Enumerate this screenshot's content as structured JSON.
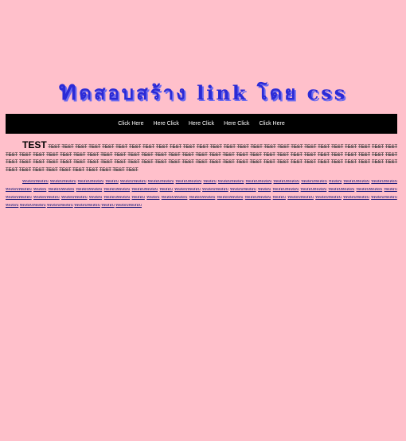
{
  "page": {
    "title_first": "ท",
    "title_rest": "ดสอบสร้าง link โดย css"
  },
  "nav": {
    "items": [
      {
        "label": "Click Here"
      },
      {
        "label": "Here Click"
      },
      {
        "label": "Here Click"
      },
      {
        "label": "Here Click"
      },
      {
        "label": "Click Here"
      }
    ]
  },
  "content": {
    "heading_word": "TEST",
    "test_word": "TEST",
    "test_count": 94,
    "link_word": "ทดสอบ",
    "link_phrases": [
      "ทดสอบทดสอบ",
      "ทดสอบทดสอบ",
      "ทดสอบทดสอบ",
      "ทดสอบ",
      "ทดสอบทดสอบ",
      "ทดสอบทดสอบ",
      "ทดสอบทดสอบ",
      "ทดสอบ",
      "ทดสอบทดสอบ",
      "ทดสอบทดสอบ",
      "ทดสอบทดสอบ",
      "ทดสอบทดสอบ",
      "ทดสอบ",
      "ทดสอบทดสอบ",
      "ทดสอบทดสอบ",
      "ทดสอบทดสอบ",
      "ทดสอบ",
      "ทดสอบทดสอบ",
      "ทดสอบทดสอบ",
      "ทดสอบทดสอบ",
      "ทดสอบทดสอบ",
      "ทดสอบ",
      "ทดสอบทดสอบ",
      "ทดสอบทดสอบ",
      "ทดสอบทดสอบ",
      "ทดสอบ",
      "ทดสอบทดสอบ",
      "ทดสอบทดสอบ",
      "ทดสอบทดสอบ",
      "ทดสอบทดสอบ",
      "ทดสอบ",
      "ทดสอบทดสอบ",
      "ทดสอบทดสอบ",
      "ทดสอบทดสอบ",
      "ทดสอบ",
      "ทดสอบทดสอบ",
      "ทดสอบ",
      "ทดสอบ",
      "ทดสอบทดสอบ",
      "ทดสอบทดสอบ",
      "ทดสอบทดสอบ",
      "ทดสอบทดสอบ",
      "ทดสอบ",
      "ทดสอบทดสอบ",
      "ทดสอบทดสอบ",
      "ทดสอบทดสอบ",
      "ทดสอบทดสอบ",
      "ทดสอบ",
      "ทดสอบทดสอบ",
      "ทดสอบทดสอบ",
      "ทดสอบทดสอบ",
      "ทดสอบ",
      "ทดสอบทดสอบ"
    ]
  }
}
